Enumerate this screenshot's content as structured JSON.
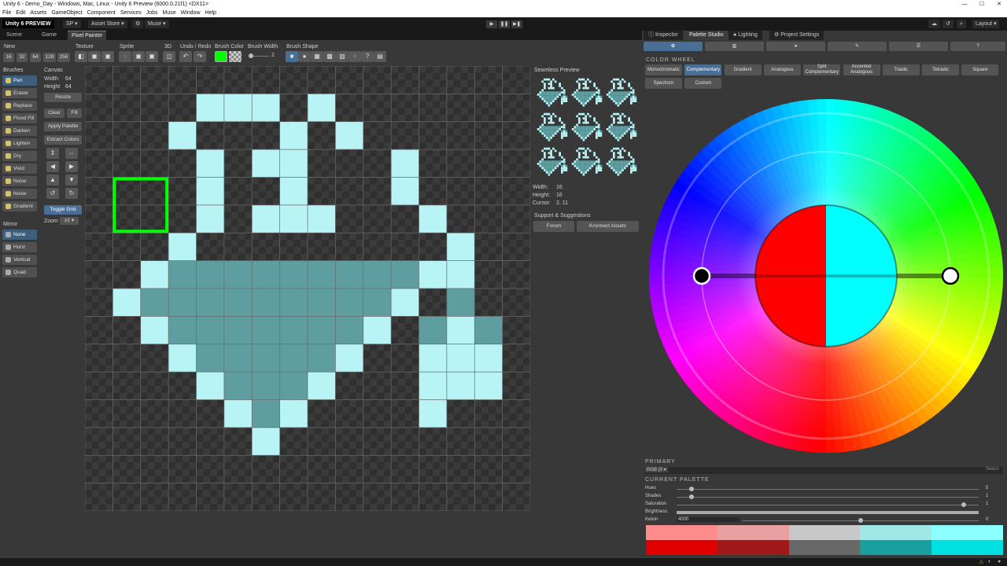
{
  "window": {
    "title": "Unity 6 - Demo_Day - Windows, Mac, Linux - Unity 6 Preview (6000.0.21f1) <DX11>"
  },
  "menu": [
    "File",
    "Edit",
    "Assets",
    "GameObject",
    "Component",
    "Services",
    "Jobs",
    "Muse",
    "Window",
    "Help"
  ],
  "toolbar": {
    "logo": "Unity 6 PREVIEW",
    "account": "SP ▾",
    "store": "Asset Store ▾",
    "muse": "Muse ▾",
    "layout": "Layout ▾"
  },
  "left_tabs": [
    "Scene",
    "Game",
    "Pixel Painter"
  ],
  "right_tabs": [
    "Inspector",
    "Palette Studio",
    "Lighting",
    "Project Settings"
  ],
  "painter": {
    "new_label": "New",
    "sizes": [
      "16",
      "32",
      "64",
      "128",
      "256"
    ],
    "groups": {
      "texture": "Texture",
      "sprite": "Sprite",
      "d3": "3D",
      "undo": "Undo / Redo",
      "color": "Brush Color",
      "width": "Brush Width",
      "shape": "Brush Shape"
    },
    "brush_width_value": "2",
    "brushes_label": "Brushes",
    "brushes": [
      "Pen",
      "Eraser",
      "Replace",
      "Flood Fill",
      "Darken",
      "Lighten",
      "Dry",
      "Vivid",
      "Noise",
      "Noise Tone",
      "Gradient"
    ],
    "mirror_label": "Mirror",
    "mirror": [
      "None",
      "Horiz",
      "Vertical",
      "Quad"
    ],
    "canvas_label": "Canvas",
    "width_label": "Width",
    "width_value": "64",
    "height_label": "Height",
    "height_value": "64",
    "buttons": {
      "resize": "Resize",
      "clear": "Clear",
      "fill": "Fill",
      "apply": "Apply Palette",
      "extract": "Extract Colors",
      "grid": "Toggle Grid"
    },
    "zoom_label": "Zoom",
    "zoom_value": "x1 ▾",
    "preview_label": "Seamless Preview",
    "info": {
      "width": "16",
      "height": "16",
      "cursor": "2, 11",
      "width_label": "Width:",
      "height_label": "Height:",
      "cursor_label": "Cursor:"
    },
    "support_label": "Support & Suggestions",
    "forum": "Forum",
    "kronnect": "Kronnect Assets",
    "brush_color": "#00ff00",
    "pixel_light": "#b8f4f6",
    "pixel_dark": "#5f9ea0",
    "pixels": [
      "................",
      "....XXX.X.......",
      "...X...X.X......",
      "....X.XX...X....",
      "..S.X..X...X....",
      "....X.XXX...X...",
      "...X.........X..",
      "..XDDDDDDDDDXX..",
      ".XDDDDDDDDDX.D..",
      "..XDDDDDDDX.DXD.",
      "...XDDDDDX..XXX.",
      "....XDDDX...XXX.",
      ".....XDX....X...",
      "......X.........",
      "................",
      "................"
    ]
  },
  "palette": {
    "section": "COLOR WHEEL",
    "modes": [
      "Monochromatic",
      "Complementary",
      "Gradient",
      "Analogous",
      "Split Complementary",
      "Accented Analogous",
      "Triadic",
      "Tetradic",
      "Square",
      "Spectrum",
      "Custom"
    ],
    "active_mode": "Complementary",
    "primary_label": "PRIMARY",
    "primary_value": "RGB (0 ▾",
    "select": "Select",
    "current_label": "CURRENT PALETTE",
    "rows": [
      {
        "name": "Hues",
        "value": "5",
        "pos": 0.05
      },
      {
        "name": "Shades",
        "value": "1",
        "pos": 0.05
      },
      {
        "name": "Saturation",
        "value": "1",
        "pos": 0.95
      },
      {
        "name": "Brightness",
        "value": "",
        "pos": 1.0
      },
      {
        "name": "Kelvin",
        "value": "0",
        "pos": 0.5,
        "input": "4000"
      }
    ],
    "wheel_left": "#ff0000",
    "wheel_right": "#00ffff",
    "swatches_top": [
      "#ff8c8c",
      "#e8a0a0",
      "#c8c8c8",
      "#a0e8e8",
      "#8cffff"
    ],
    "swatches_bottom": [
      "#e00000",
      "#a01818",
      "#686868",
      "#18a0a0",
      "#00e0e0"
    ]
  }
}
